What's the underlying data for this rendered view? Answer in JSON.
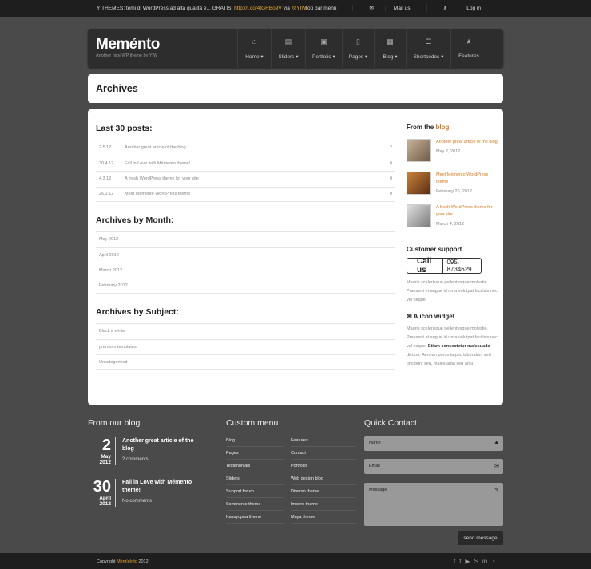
{
  "topbar": {
    "promo_prefix": "YITHEMES: temi di WordPress ad alta qualità e... GRATIS! ",
    "promo_link": "http://t.co/4IGRBo9V",
    "promo_via": " via ",
    "promo_handle": "@YIW",
    "menu": "Top bar menu",
    "mail": "Mail us",
    "login": "Log in"
  },
  "header": {
    "logo": "Memento",
    "tagline": "Another nice WP theme by YIW",
    "nav": [
      {
        "label": "Home ▾",
        "icon": "home-icon"
      },
      {
        "label": "Sliders ▾",
        "icon": "film-icon"
      },
      {
        "label": "Portfolio ▾",
        "icon": "image-icon"
      },
      {
        "label": "Pages ▾",
        "icon": "page-icon"
      },
      {
        "label": "Blog ▾",
        "icon": "calendar-icon"
      },
      {
        "label": "Shortcodes ▾",
        "icon": "list-icon"
      },
      {
        "label": "Features",
        "icon": "star-icon"
      }
    ]
  },
  "page_title": "Archives",
  "main": {
    "last30_title": "Last 30 posts:",
    "posts": [
      {
        "date": "2.5.12",
        "title": "Another great article of the blog",
        "count": "2"
      },
      {
        "date": "30.4.12",
        "title": "Fall in Love with Mémento theme!",
        "count": "0"
      },
      {
        "date": "4.3.12",
        "title": "A fresh WordPress theme for your site",
        "count": "0"
      },
      {
        "date": "26.2.12",
        "title": "Meet Mémento WordPress theme",
        "count": "0"
      }
    ],
    "month_title": "Archives by Month:",
    "months": [
      "May 2012",
      "April 2012",
      "March 2012",
      "February 2012"
    ],
    "subject_title": "Archives by Subject:",
    "subjects": [
      "Black e white",
      "premium templates",
      "Uncategorized"
    ]
  },
  "sidebar": {
    "from_prefix": "From the ",
    "from_blog": "blog",
    "posts": [
      {
        "title": "Another great article of the blog",
        "date": "May 2, 2012"
      },
      {
        "title": "Meet Mémento WordPress theme",
        "date": "February 26, 2012"
      },
      {
        "title": "A fresh WordPress theme for your site",
        "date": "March 4, 2012"
      }
    ],
    "support_title": "Customer support",
    "callus": "Call us",
    "phone": "095. 8734629",
    "support_text": "Mauris scelerisque pellentesque molestie. Praesent et augue id urna volutpat facilisis nec vel neque.",
    "widget_title": "A icon widget",
    "widget_text_a": "Mauris scelerisque pellentesque molestie. Praesent et augue id urna volutpat facilisis nec vel neque. ",
    "widget_text_bold": "Etiam consectetur malesuada",
    "widget_text_b": " dictum. Aenean purus turpis, bibendum sed tincidunt sed, malesuada sed arcu."
  },
  "footer": {
    "blog_title": "From our blog",
    "blog": [
      {
        "day": "2",
        "month": "May",
        "year": "2012",
        "title": "Another great article of the blog",
        "comments": "2 comments"
      },
      {
        "day": "30",
        "month": "April",
        "year": "2012",
        "title": "Fall in Love with Mémento theme!",
        "comments": "No comments"
      }
    ],
    "menu_title": "Custom menu",
    "menu_left": [
      "Blog",
      "Pages",
      "Testimonials",
      "Sliders",
      "Support forum",
      "Sommerce theme",
      "Kassyopea theme"
    ],
    "menu_right": [
      "Features",
      "Contact",
      "Portfolio",
      "Web design blog",
      "Diverso theme",
      "Impero theme",
      "Maya theme"
    ],
    "contact_title": "Quick Contact",
    "name_ph": "Name",
    "email_ph": "Email",
    "message_ph": "Message",
    "send": "send message"
  },
  "bottom": {
    "copyright_prefix": "Copyright ",
    "brand": "Mem|é|nto",
    "year": " 2012"
  }
}
